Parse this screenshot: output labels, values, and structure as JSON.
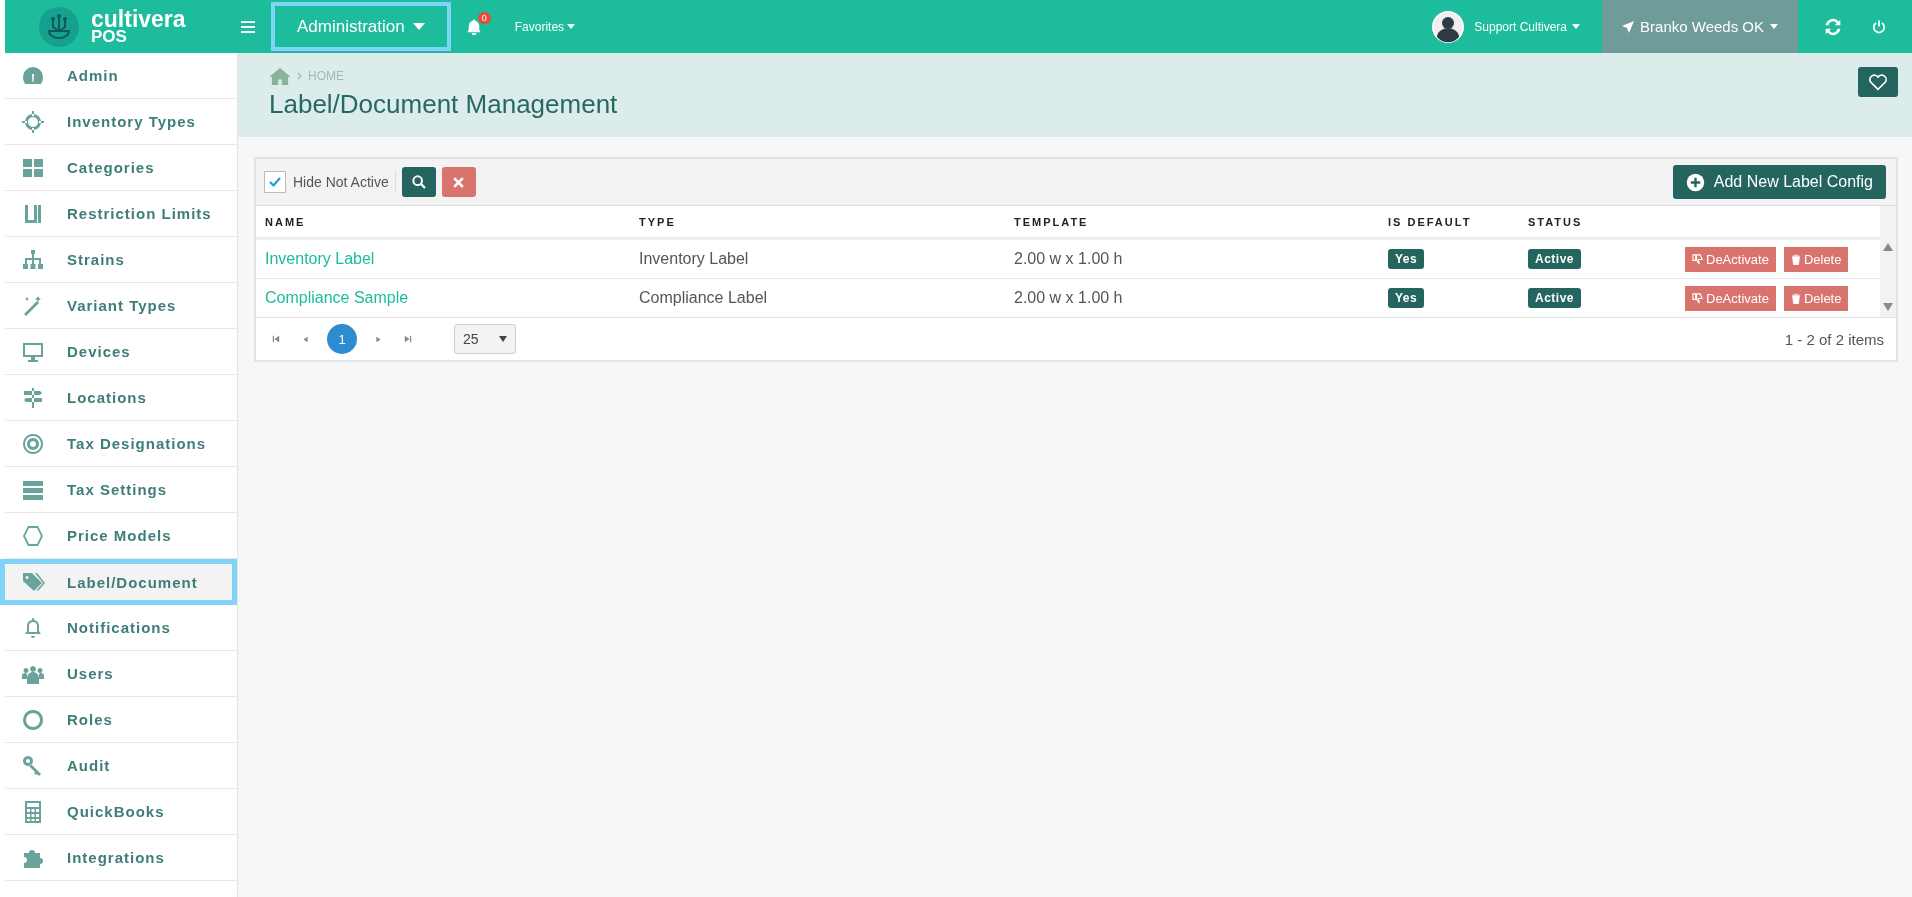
{
  "topbar": {
    "logo_name": "cultivera",
    "logo_sub": "POS",
    "module_menu": "Administration",
    "notifications": "0",
    "favorites": "Favorites",
    "user": "Support Cultivera",
    "location": "Branko Weeds OK"
  },
  "sidebar": {
    "items": [
      {
        "label": "Admin",
        "selected": false
      },
      {
        "label": "Inventory Types",
        "selected": false
      },
      {
        "label": "Categories",
        "selected": false
      },
      {
        "label": "Restriction Limits",
        "selected": false
      },
      {
        "label": "Strains",
        "selected": false
      },
      {
        "label": "Variant Types",
        "selected": false
      },
      {
        "label": "Devices",
        "selected": false
      },
      {
        "label": "Locations",
        "selected": false
      },
      {
        "label": "Tax Designations",
        "selected": false
      },
      {
        "label": "Tax Settings",
        "selected": false
      },
      {
        "label": "Price Models",
        "selected": false
      },
      {
        "label": "Label/Document",
        "selected": true
      },
      {
        "label": "Notifications",
        "selected": false
      },
      {
        "label": "Users",
        "selected": false
      },
      {
        "label": "Roles",
        "selected": false
      },
      {
        "label": "Audit",
        "selected": false
      },
      {
        "label": "QuickBooks",
        "selected": false
      },
      {
        "label": "Integrations",
        "selected": false
      }
    ]
  },
  "breadcrumb": "HOME",
  "page_title": "Label/Document Management",
  "toolbar": {
    "hide_not_active": {
      "label": "Hide Not Active",
      "checked": true
    },
    "add_button": "Add New Label Config"
  },
  "table": {
    "columns": [
      "NAME",
      "TYPE",
      "TEMPLATE",
      "IS DEFAULT",
      "STATUS"
    ],
    "rows": [
      {
        "name": "Inventory Label",
        "type": "Inventory Label",
        "template": "2.00 w x 1.00 h",
        "is_default": "Yes",
        "status": "Active",
        "deactivate": "DeActivate",
        "delete": "Delete"
      },
      {
        "name": "Compliance Sample",
        "type": "Compliance Label",
        "template": "2.00 w x 1.00 h",
        "is_default": "Yes",
        "status": "Active",
        "deactivate": "DeActivate",
        "delete": "Delete"
      }
    ]
  },
  "pager": {
    "pages": [
      {
        "label": "1",
        "selected": true
      }
    ],
    "page_size": "25",
    "summary": "1 - 2 of 2 items"
  }
}
